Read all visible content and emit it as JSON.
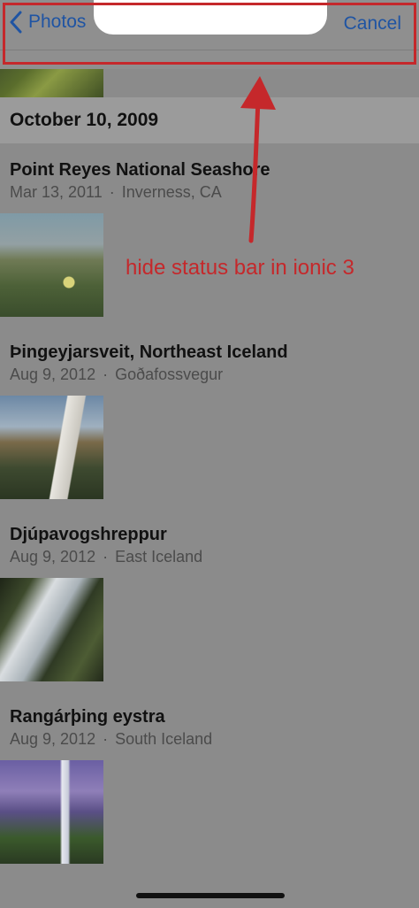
{
  "nav": {
    "back_label": "Photos",
    "cancel_label": "Cancel"
  },
  "section": {
    "date": "October 10, 2009"
  },
  "entries": [
    {
      "title": "Point Reyes National Seashore",
      "date": "Mar 13, 2011",
      "separator": "·",
      "location": "Inverness, CA",
      "thumb_icon": "landscape-photo"
    },
    {
      "title": "Þingeyjarsveit, Northeast Iceland",
      "date": "Aug 9, 2012",
      "separator": "·",
      "location": "Goðafossvegur",
      "thumb_icon": "waterfall-photo"
    },
    {
      "title": "Djúpavogshreppur",
      "date": "Aug 9, 2012",
      "separator": "·",
      "location": "East Iceland",
      "thumb_icon": "waterfall-photo"
    },
    {
      "title": "Rangárþing eystra",
      "date": "Aug 9, 2012",
      "separator": "·",
      "location": "South Iceland",
      "thumb_icon": "waterfall-photo"
    }
  ],
  "annotation": {
    "text": "hide status bar in ionic 3",
    "color": "#c5282b"
  },
  "colors": {
    "accent": "#1f54a3",
    "highlight": "#c5282b"
  }
}
